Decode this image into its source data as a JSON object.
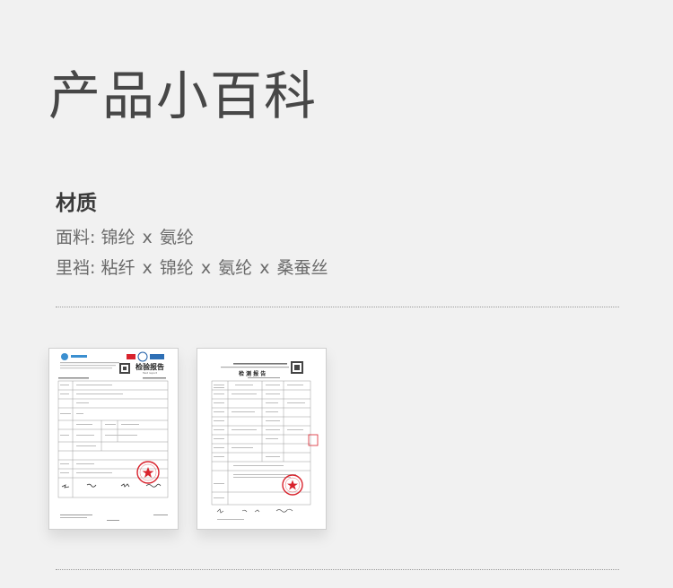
{
  "header": {
    "title": "产品小百科"
  },
  "material": {
    "label": "材质",
    "fabric": {
      "prefix": "面料:",
      "items": [
        "锦纶",
        "x",
        "氨纶"
      ]
    },
    "lining": {
      "prefix": "里裆:",
      "items": [
        "粘纤",
        "x",
        "锦纶",
        "x",
        "氨纶",
        "x",
        "桑蚕丝"
      ]
    }
  },
  "documents": {
    "left": {
      "name": "test-report-left",
      "heading": "检验报告",
      "subheading": "Test report",
      "stamp_color": "#d9232d"
    },
    "right": {
      "name": "test-report-right",
      "heading": "检 测 报 告",
      "stamp_color": "#d9232d"
    }
  },
  "colors": {
    "background": "#f1f1f1",
    "title": "#474747",
    "body_text": "#6a6a6a",
    "stamp": "#d9232d"
  }
}
